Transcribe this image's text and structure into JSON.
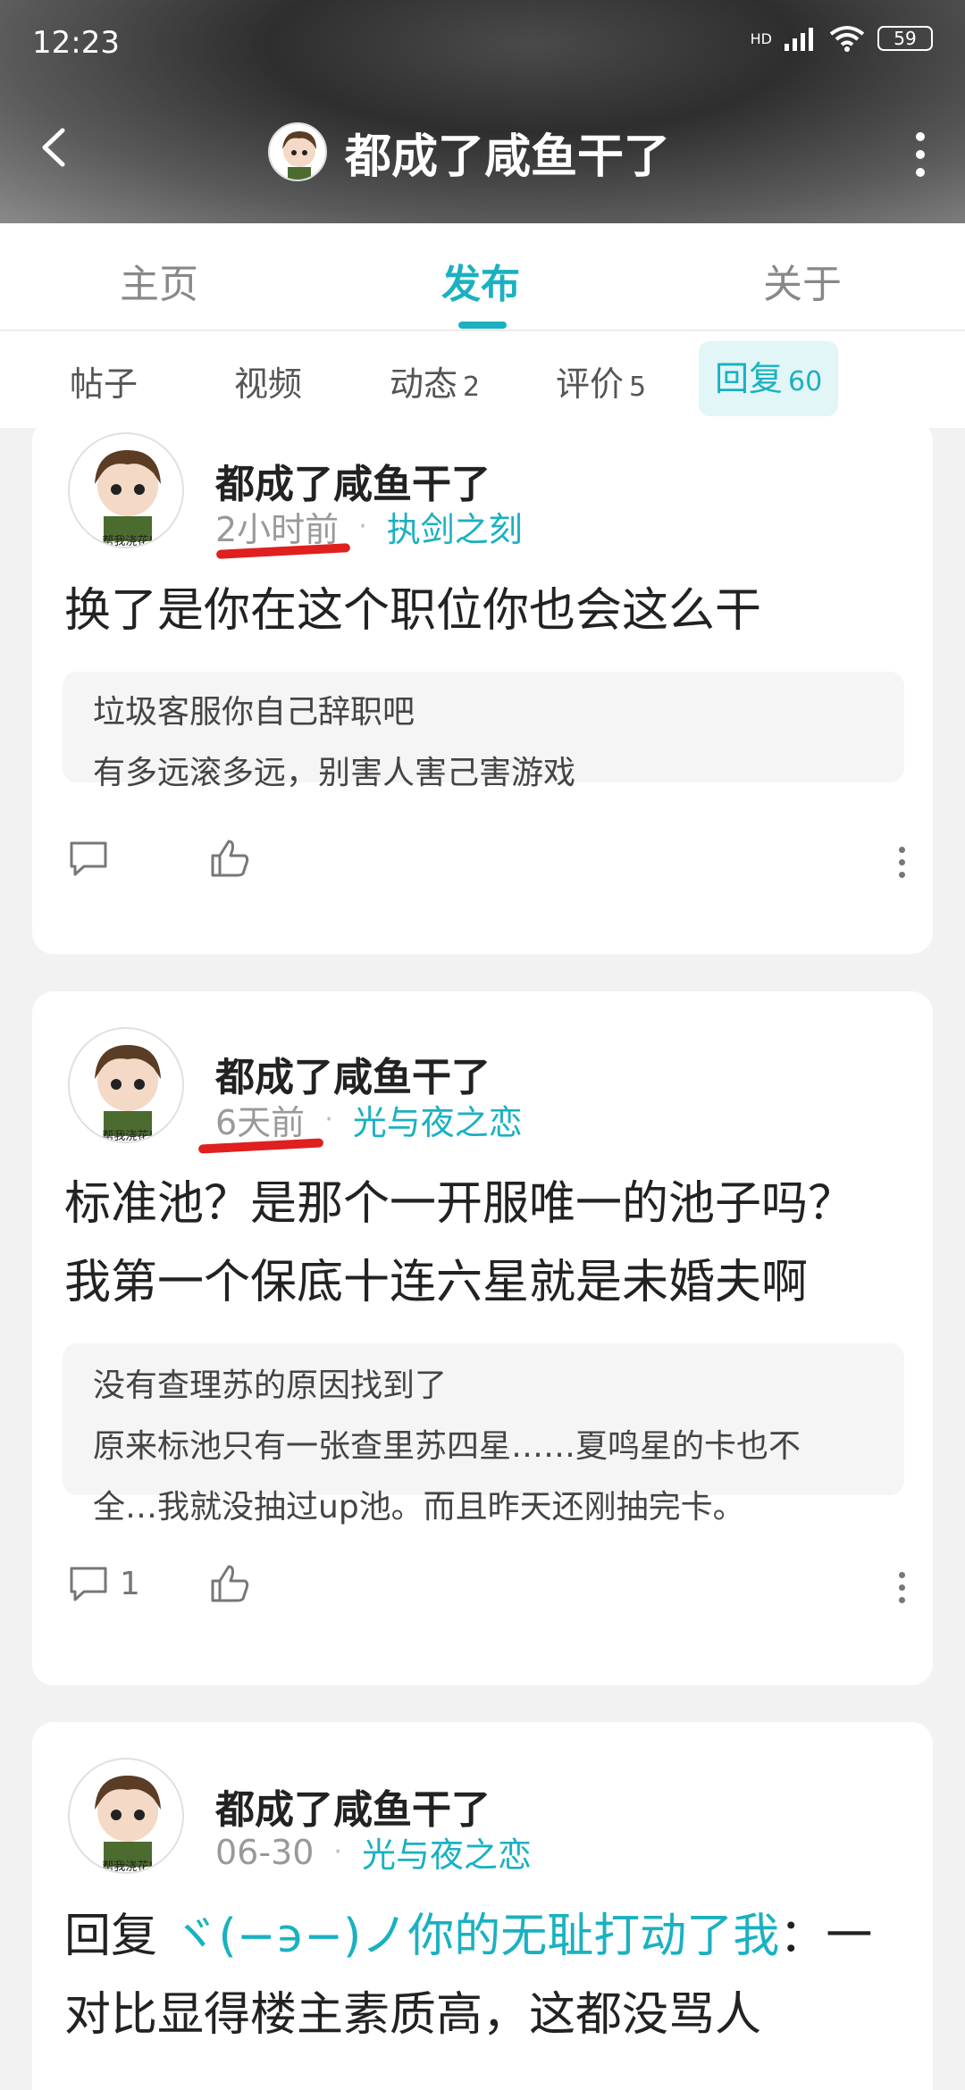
{
  "status_bar": {
    "time": "12:23",
    "network": "HD",
    "battery": "59"
  },
  "header": {
    "title": "都成了咸鱼干了"
  },
  "main_tabs": [
    {
      "label": "主页"
    },
    {
      "label": "发布"
    },
    {
      "label": "关于"
    }
  ],
  "sub_tabs": [
    {
      "label": "帖子",
      "count": ""
    },
    {
      "label": "视频",
      "count": ""
    },
    {
      "label": "动态",
      "count": "2"
    },
    {
      "label": "评价",
      "count": "5"
    },
    {
      "label": "回复",
      "count": "60"
    }
  ],
  "posts": [
    {
      "username": "都成了咸鱼干了",
      "time": "2小时前",
      "game": "执剑之刻",
      "content": "换了是你在这个职位你也会这么干",
      "quote_lines": [
        "垃圾客服你自己辞职吧",
        "有多远滚多远，别害人害己害游戏"
      ],
      "comment_count": ""
    },
    {
      "username": "都成了咸鱼干了",
      "time": "6天前",
      "game": "光与夜之恋",
      "content_lines": [
        "标准池？是那个一开服唯一的池子吗？",
        "我第一个保底十连六星就是未婚夫啊"
      ],
      "quote_lines": [
        "没有查理苏的原因找到了",
        "原来标池只有一张查里苏四星……夏鸣星的卡也不",
        "全…我就没抽过up池。而且昨天还刚抽完卡。"
      ],
      "comment_count": "1"
    },
    {
      "username": "都成了咸鱼干了",
      "time": "06-30",
      "game": "光与夜之恋",
      "reply_prefix": "回复",
      "reply_target": "ヾ(−϶−)ノ你的无耻打动了我",
      "reply_rest": "：一",
      "content_line2": "对比显得楼主素质高，这都没骂人"
    }
  ],
  "avatar_caption": "帮我浇花!",
  "colors": {
    "accent": "#1ab1c1",
    "annotation": "#e01f1f"
  }
}
